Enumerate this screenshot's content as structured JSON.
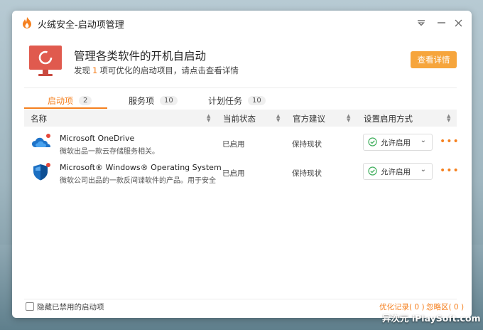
{
  "window": {
    "title": "火绒安全-启动项管理"
  },
  "header": {
    "title": "管理各类软件的开机自启动",
    "sub_prefix": "发现",
    "sub_count": "1",
    "sub_suffix": "项可优化的启动项目，请点击查看详情",
    "detail_button": "查看详情"
  },
  "tabs": [
    {
      "label": "启动项",
      "count": "2",
      "active": true
    },
    {
      "label": "服务项",
      "count": "10",
      "active": false
    },
    {
      "label": "计划任务",
      "count": "10",
      "active": false
    }
  ],
  "table": {
    "columns": [
      "名称",
      "当前状态",
      "官方建议",
      "设置启用方式"
    ],
    "rows": [
      {
        "name": "Microsoft OneDrive",
        "desc": "微软出品一款云存储服务相关。",
        "status": "已启用",
        "advice": "保持现状",
        "mode": "允许启用"
      },
      {
        "name": "Microsoft® Windows® Operating System",
        "desc": "微软公司出品的一款反间谍软件的产品。用于安全辅助…",
        "status": "已启用",
        "advice": "保持现状",
        "mode": "允许启用"
      }
    ]
  },
  "footer": {
    "hide_disabled_label": "隐藏已禁用的启动项",
    "optimize_log": "优化记录( 0 )",
    "ignore_zone": "忽略区( 0 )"
  },
  "watermark": "异次元 iPlaySoft.com",
  "colors": {
    "accent": "#f5801f",
    "button": "#f6a53c",
    "ok_green": "#3fae5c"
  }
}
